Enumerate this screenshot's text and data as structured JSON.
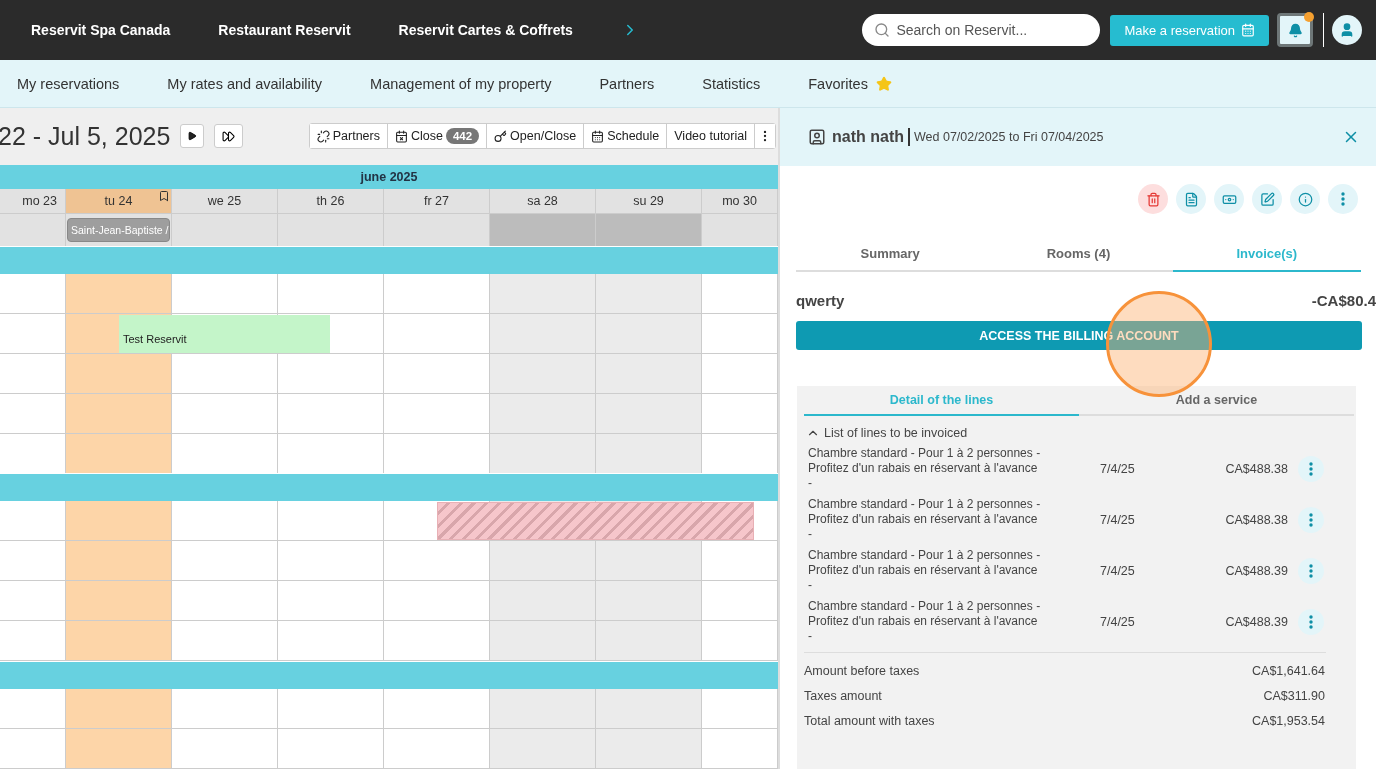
{
  "top_bar": {
    "links": [
      "Reservit Spa Canada",
      "Restaurant Reservit",
      "Reservit Cartes & Coffrets"
    ],
    "search": {
      "placeholder": "Search on Reservit..."
    },
    "reserve_button": "Make a reservation",
    "notifications": {
      "unread": true
    }
  },
  "menu": [
    {
      "label": "My reservations",
      "starred": false
    },
    {
      "label": "My rates and availability",
      "starred": false
    },
    {
      "label": "Management of my property",
      "starred": false
    },
    {
      "label": "Partners",
      "starred": false
    },
    {
      "label": "Statistics",
      "starred": false
    },
    {
      "label": "Favorites",
      "starred": true
    }
  ],
  "calendar": {
    "date_range": "22 - Jul 5, 2025",
    "toolbar": [
      {
        "kind": "partners",
        "label": "Partners"
      },
      {
        "kind": "close",
        "label": "Close",
        "badge": "442"
      },
      {
        "kind": "openclose",
        "label": "Open/Close"
      },
      {
        "kind": "schedule",
        "label": "Schedule"
      },
      {
        "kind": "video",
        "label": "Video tutorial"
      }
    ],
    "month": "june 2025",
    "days": [
      {
        "label": "mo 23",
        "highlighted": false,
        "weekend": false,
        "bookmarked": false
      },
      {
        "label": "tu 24",
        "highlighted": true,
        "weekend": false,
        "bookmarked": true,
        "holiday": "Saint-Jean-Baptiste /"
      },
      {
        "label": "we 25",
        "highlighted": false,
        "weekend": false,
        "bookmarked": false
      },
      {
        "label": "th 26",
        "highlighted": false,
        "weekend": false,
        "bookmarked": false
      },
      {
        "label": "fr 27",
        "highlighted": false,
        "weekend": false,
        "bookmarked": false
      },
      {
        "label": "sa 28",
        "highlighted": false,
        "weekend": true,
        "bookmarked": false
      },
      {
        "label": "su 29",
        "highlighted": false,
        "weekend": true,
        "bookmarked": false
      },
      {
        "label": "mo 30",
        "highlighted": false,
        "weekend": false,
        "bookmarked": false
      }
    ],
    "events": [
      {
        "kind": "booking",
        "label": "Test Reservit"
      },
      {
        "kind": "blocked"
      }
    ]
  },
  "panel": {
    "guest": "nath nath",
    "dates": "Wed 07/02/2025 to Fri 07/04/2025",
    "actions": [
      {
        "kind": "delete"
      },
      {
        "kind": "document"
      },
      {
        "kind": "billing"
      },
      {
        "kind": "edit"
      },
      {
        "kind": "info"
      },
      {
        "kind": "more"
      }
    ],
    "tabs": [
      {
        "label": "Summary",
        "selected": false
      },
      {
        "label": "Rooms (4)",
        "selected": false
      },
      {
        "label": "Invoice(s)",
        "selected": true
      }
    ],
    "invoice": {
      "name": "qwerty",
      "amount": "-CA$80.4",
      "button": "ACCESS THE BILLING ACCOUNT",
      "click_marker": true,
      "subtabs": [
        {
          "label": "Detail of the lines",
          "selected": true
        },
        {
          "label": "Add a service",
          "selected": false
        }
      ],
      "list_title": "List of lines to be invoiced",
      "expanded": true,
      "lines": [
        {
          "description": "Chambre standard - Pour 1 à 2 personnes - Profitez d'un rabais en réservant à l'avance -",
          "date": "7/4/25",
          "amount": "CA$488.38"
        },
        {
          "description": "Chambre standard - Pour 1 à 2 personnes - Profitez d'un rabais en réservant à l'avance -",
          "date": "7/4/25",
          "amount": "CA$488.38"
        },
        {
          "description": "Chambre standard - Pour 1 à 2 personnes - Profitez d'un rabais en réservant à l'avance -",
          "date": "7/4/25",
          "amount": "CA$488.39"
        },
        {
          "description": "Chambre standard - Pour 1 à 2 personnes - Profitez d'un rabais en réservant à l'avance -",
          "date": "7/4/25",
          "amount": "CA$488.39"
        }
      ],
      "totals": [
        {
          "label": "Amount before taxes",
          "value": "CA$1,641.64"
        },
        {
          "label": "Taxes amount",
          "value": "CA$311.90"
        },
        {
          "label": "Total amount with taxes",
          "value": "CA$1,953.54"
        }
      ]
    }
  }
}
